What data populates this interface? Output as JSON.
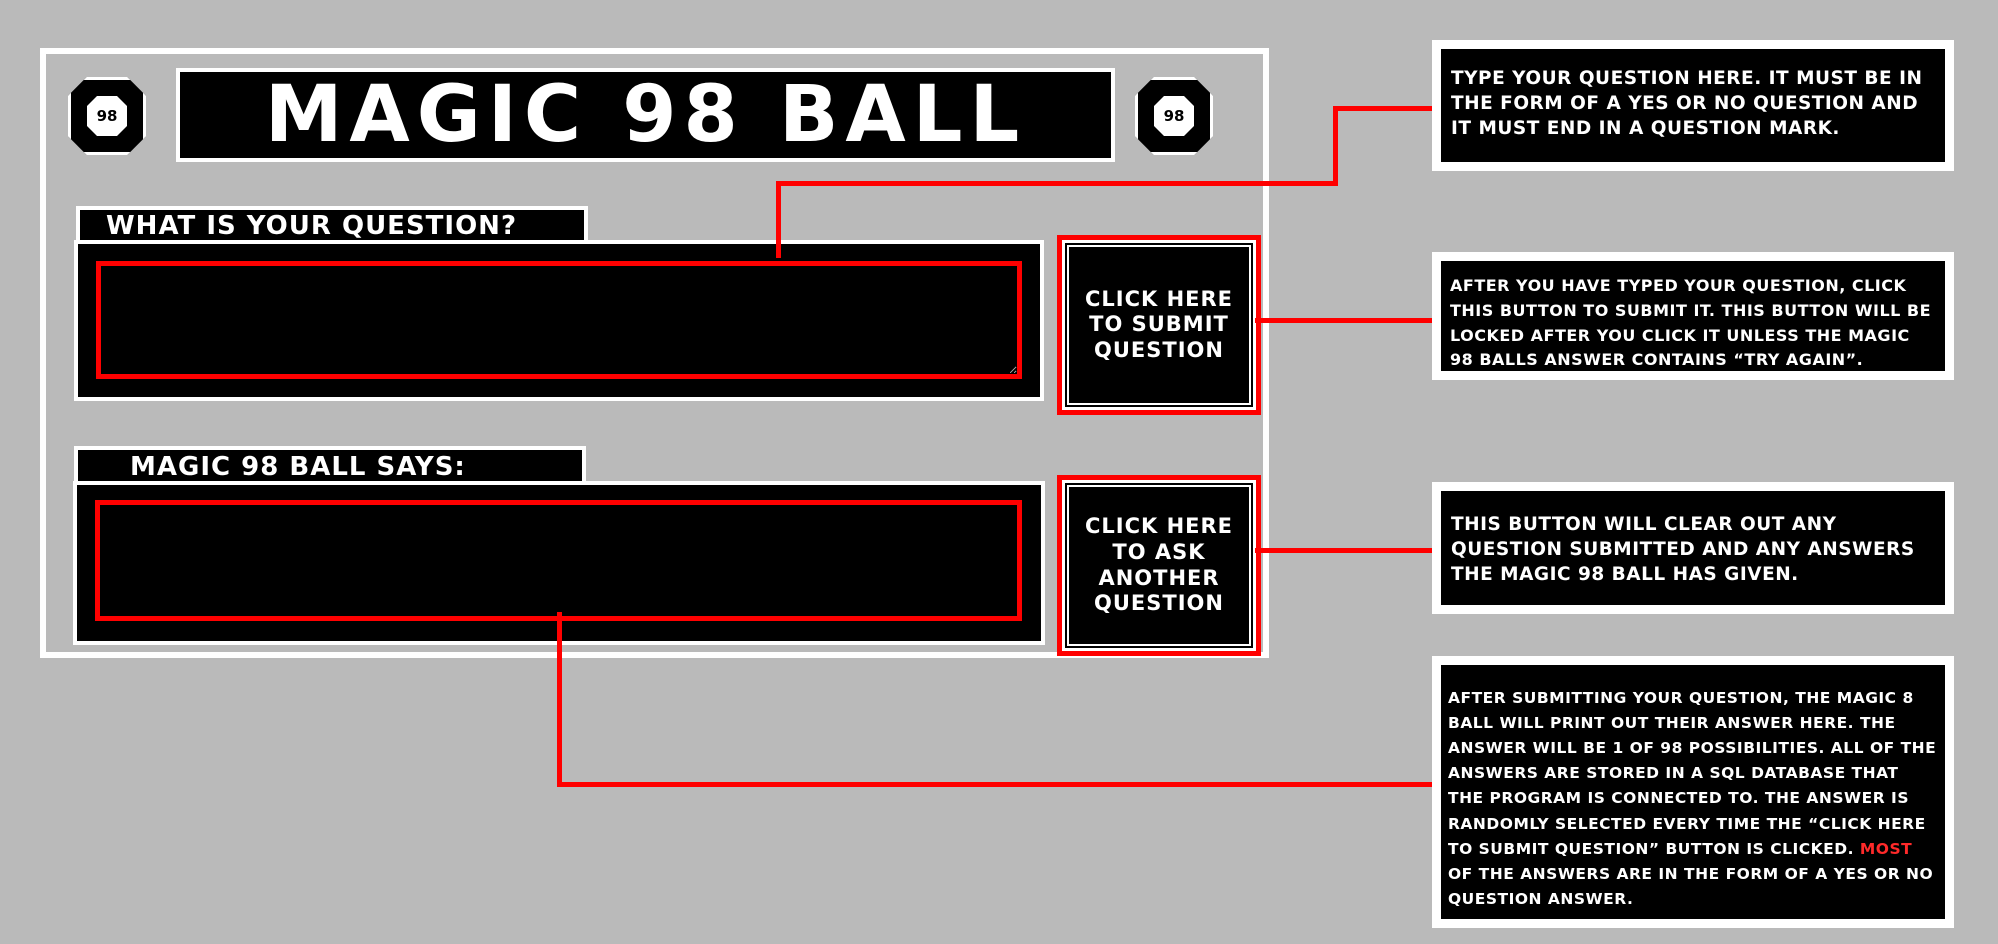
{
  "app": {
    "title": "MAGIC 98 BALL",
    "ball_badge": "98"
  },
  "question": {
    "label": "WHAT IS YOUR QUESTION?",
    "value": ""
  },
  "answer": {
    "label": "MAGIC 98 BALL SAYS:",
    "value": ""
  },
  "buttons": {
    "submit": "CLICK HERE\nTO SUBMIT\nQUESTION",
    "ask_another": "CLICK HERE\nTO ASK\nANOTHER\nQUESTION"
  },
  "annotations": {
    "question_field": "TYPE YOUR QUESTION HERE. IT MUST BE IN THE FORM OF A YES OR NO QUESTION AND IT MUST END IN A QUESTION MARK.",
    "submit_button": "AFTER YOU HAVE TYPED YOUR QUESTION, CLICK THIS BUTTON TO SUBMIT IT. THIS BUTTON WILL BE LOCKED AFTER YOU CLICK IT UNLESS THE MAGIC 98 BALLS ANSWER CONTAINS “TRY AGAIN”.",
    "ask_another_button": "THIS BUTTON WILL CLEAR OUT ANY QUESTION SUBMITTED AND ANY ANSWERS THE MAGIC 98 BALL HAS GIVEN.",
    "answer_field": {
      "before": "AFTER SUBMITTING YOUR QUESTION, THE MAGIC 8 BALL WILL PRINT OUT THEIR ANSWER HERE. THE ANSWER WILL BE 1 OF 98 POSSIBILITIES. ALL OF THE ANSWERS ARE STORED IN A SQL DATABASE THAT THE PROGRAM IS CONNECTED TO. THE ANSWER IS RANDOMLY SELECTED EVERY TIME THE “CLICK HERE TO SUBMIT QUESTION” BUTTON IS CLICKED. ",
      "highlight": "MOST",
      "after": " OF THE ANSWERS ARE IN THE FORM OF A YES OR NO QUESTION ANSWER."
    }
  },
  "colors": {
    "background": "#bababa",
    "panel": "#000000",
    "border": "#ffffff",
    "accent": "#ff0000"
  }
}
